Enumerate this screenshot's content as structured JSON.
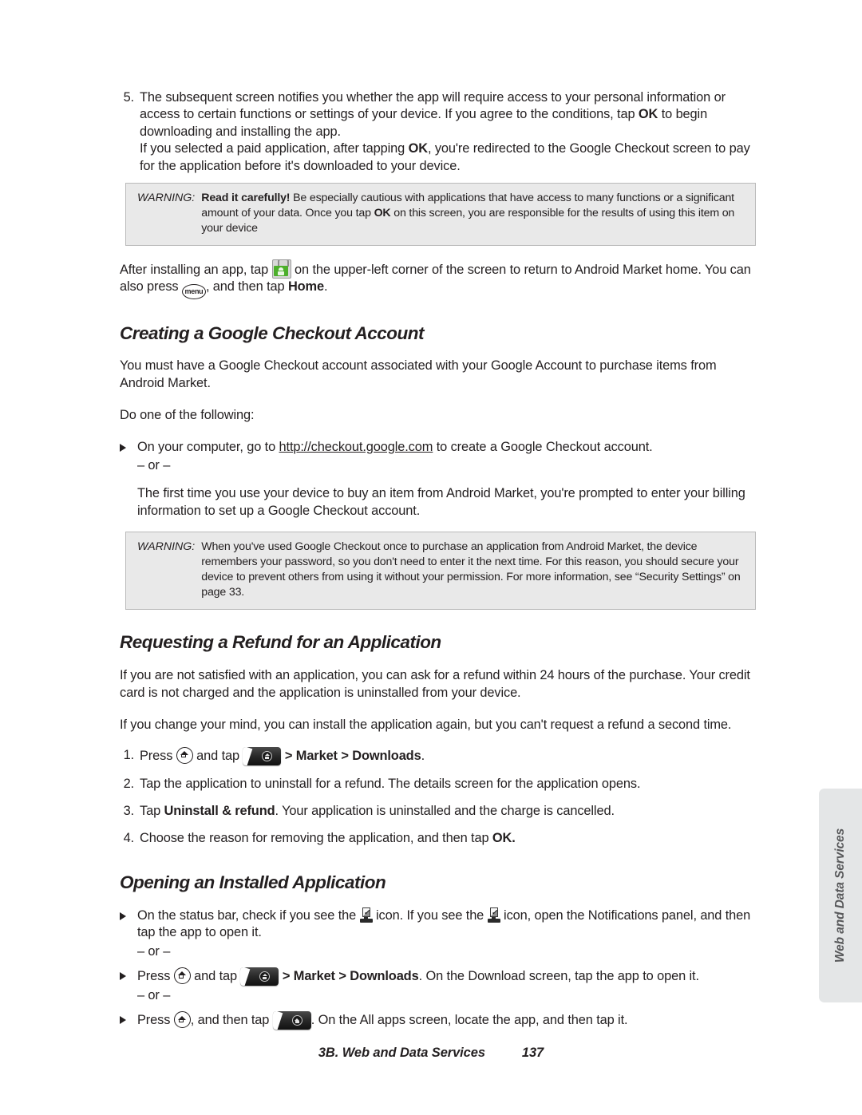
{
  "document": {
    "footer_section": "3B. Web and Data Services",
    "footer_page": "137",
    "side_tab": "Web and Data Services"
  },
  "step5": {
    "number": "5.",
    "line1_a": "The subsequent screen notifies you whether the app will require access to your personal information or access to certain functions or settings of your device. If you agree to the conditions, tap ",
    "line1_bold": "OK",
    "line1_b": " to begin downloading and installing the app.",
    "line2_a": "If you selected a paid application, after tapping ",
    "line2_bold": "OK",
    "line2_b": ", you're redirected to the Google Checkout screen to pay for the application before it's downloaded to your device."
  },
  "warning1": {
    "label": "WARNING:",
    "bold_lead": "Read it carefully!",
    "text_a": " Be especially cautious with applications that have access to many functions or a significant amount of your data. Once you tap ",
    "bold_ok": "OK",
    "text_b": " on this screen, you are responsible for the results of using this item on your device"
  },
  "after_install": {
    "text_a": "After installing an app, tap ",
    "icon_market": "market-bag-icon",
    "text_b": " on the upper-left corner of the screen to return to Android Market home. You can also press ",
    "icon_menu_label": "menu",
    "text_c": ", and then tap ",
    "bold_home": "Home",
    "text_d": "."
  },
  "section_checkout": {
    "heading": "Creating a Google Checkout Account",
    "para1": "You must have a Google Checkout account associated with your Google Account to purchase items from Android Market.",
    "para2": "Do one of the following:",
    "bullet1_a": "On your computer, go to ",
    "bullet1_link": "http://checkout.google.com",
    "bullet1_b": " to create a Google Checkout account.",
    "or": "– or –",
    "para3": "The first time you use your device to buy an item from Android Market, you're prompted to enter your billing information to set up a Google Checkout account."
  },
  "warning2": {
    "label": "WARNING:",
    "text": "When you've used Google Checkout once to purchase an application from Android Market, the device remembers your password, so you don't need to enter it the next time. For this reason, you should secure your device to prevent others from using it without your permission. For more information, see “Security Settings” on page 33."
  },
  "section_refund": {
    "heading": "Requesting a Refund for an Application",
    "para1": "If you are not satisfied with an application, you can ask for a refund within 24 hours of the purchase. Your credit card is not charged and the application is uninstalled from your device.",
    "para2": "If you change your mind, you can install the application again, but you can't request a refund a second time.",
    "steps": [
      {
        "number": "1.",
        "text_a": "Press ",
        "icon_home": "home-key-icon",
        "text_b": " and tap ",
        "icon_launcher": "all-apps-launcher-icon",
        "text_c": " > ",
        "bold_market": "Market",
        "text_d": " > ",
        "bold_downloads": "Downloads",
        "text_e": "."
      },
      {
        "number": "2.",
        "text": "Tap the application to uninstall for a refund. The details screen for the application opens."
      },
      {
        "number": "3.",
        "text_a": "Tap ",
        "bold": "Uninstall & refund",
        "text_b": ". Your application is uninstalled and the charge is cancelled."
      },
      {
        "number": "4.",
        "text_a": "Choose the reason for removing the application, and then tap ",
        "bold": "OK.",
        "text_b": ""
      }
    ]
  },
  "section_opening": {
    "heading": "Opening an Installed Application",
    "bullet1_a": "On the status bar, check if you see the ",
    "icon_dl1": "download-complete-icon",
    "bullet1_b": " icon. If you see the ",
    "icon_dl2": "download-complete-icon",
    "bullet1_c": " icon, open the Notifications panel, and then tap the app to open it.",
    "or1": "– or –",
    "bullet2_a": "Press ",
    "bullet2_b": " and tap ",
    "bullet2_c": " > ",
    "bullet2_market": "Market",
    "bullet2_d": " > ",
    "bullet2_downloads": "Downloads",
    "bullet2_e": ". On the Download screen, tap the app to open it.",
    "or2": "– or –",
    "bullet3_a": "Press ",
    "bullet3_b": ", and then tap ",
    "bullet3_c": ". On the All apps screen, locate the app, and then tap it."
  }
}
